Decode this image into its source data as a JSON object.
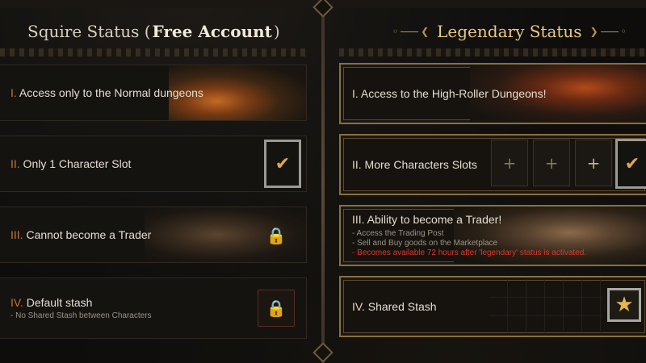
{
  "left_column": {
    "title_prefix": "Squire Status (",
    "title_strong": "Free Account",
    "title_suffix": ")",
    "rows": [
      {
        "num": "I.",
        "label": " Access only to the Normal dungeons"
      },
      {
        "num": "II.",
        "label": " Only 1 Character Slot"
      },
      {
        "num": "III.",
        "label": " Cannot become a Trader"
      },
      {
        "num": "IV.",
        "label": " Default stash",
        "sub": "- No Shared Stash between Characters"
      }
    ]
  },
  "right_column": {
    "title": "Legendary Status",
    "rows": [
      {
        "num": "I.",
        "label": " Access to the High-Roller Dungeons!"
      },
      {
        "num": "II.",
        "label": " More Characters Slots"
      },
      {
        "num": "III.",
        "label": " Ability to become a Trader!",
        "subs": [
          "- Access the Trading Post",
          "- Sell and Buy goods on the Marketplace"
        ],
        "sub_red": "- Becomes available 72 hours after 'legendary' status is activated."
      },
      {
        "num": "IV.",
        "label": " Shared Stash"
      }
    ]
  },
  "icons": {
    "check": "✔",
    "plus": "+",
    "lock": "🔒",
    "star": "★"
  },
  "colors": {
    "accent_gold": "#e8c985",
    "numeral_orange": "#c9713e",
    "warning_red": "#e0352a",
    "frame_gold": "#8a703f"
  }
}
